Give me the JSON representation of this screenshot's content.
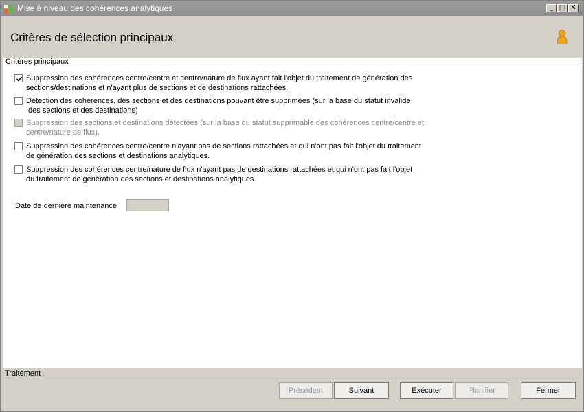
{
  "window": {
    "title": "Mise à niveau des cohérences analytiques",
    "controls": {
      "minimize": "_",
      "maximize": "□",
      "close": "✕"
    }
  },
  "header": {
    "title": "Critères de sélection principaux",
    "user_icon": "user-icon"
  },
  "criteria": {
    "group_label": "Critères principaux",
    "options": [
      {
        "checked": true,
        "enabled": true,
        "line1": "Suppression des cohérences centre/centre et centre/nature de flux ayant fait l'objet du traitement de génération des",
        "line2": "sections/destinations et n'ayant plus de sections et de destinations rattachées."
      },
      {
        "checked": false,
        "enabled": true,
        "line1": "Détection des cohérences, des sections et des destinations pouvant être supprimées (sur la base du statut invalide",
        "line2": " des sections et des destinations)"
      },
      {
        "checked": false,
        "enabled": false,
        "line1": "Suppression des sections et destinations détectées (sur la base du statut supprimable des cohérences centre/centre et",
        "line2": "centre/nature de flux)."
      },
      {
        "checked": false,
        "enabled": true,
        "line1": "Suppression des cohérences centre/centre n'ayant pas de sections rattachées et qui n'ont pas fait l'objet du traitement",
        "line2": "de génération des sections et destinations analytiques."
      },
      {
        "checked": false,
        "enabled": true,
        "line1": "Suppression des cohérences centre/nature de flux n'ayant pas de destinations rattachées et qui n'ont pas fait l'objet",
        "line2": "du traitement de génération des sections et destinations analytiques."
      }
    ],
    "last_maintenance": {
      "label": "Date de dernière maintenance :",
      "value": ""
    }
  },
  "footer": {
    "label": "Traitement",
    "buttons": {
      "previous": "Précédent",
      "next": "Suivant",
      "execute": "Exécuter",
      "schedule": "Planifier",
      "close": "Fermer"
    }
  },
  "colors": {
    "title_bar": "#9a9a9a",
    "chrome": "#d4d0c8",
    "user_icon": "#f0a020"
  }
}
